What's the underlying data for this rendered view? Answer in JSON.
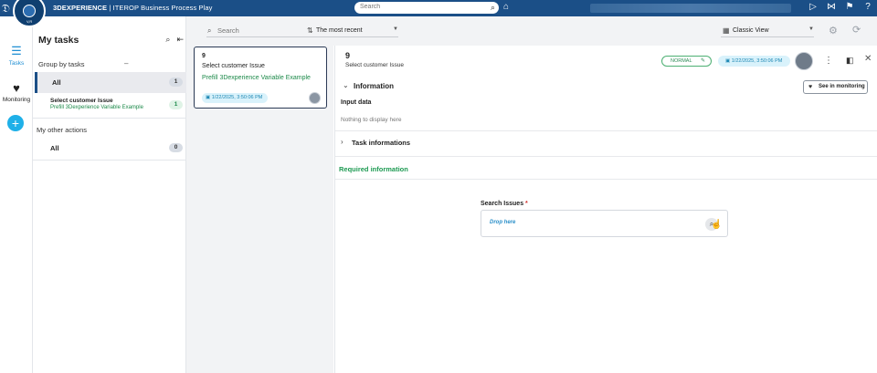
{
  "header": {
    "brand_bold": "3DEXPERIENCE",
    "brand_rest": " | ITEROP Business Process Play",
    "search_placeholder": "Search",
    "compass_version": "V,R",
    "blurred": true
  },
  "rail": {
    "tasks_label": "Tasks",
    "monitoring_label": "Monitoring",
    "add_label": "+"
  },
  "tasks_panel": {
    "title": "My tasks",
    "group_by": "Group by tasks",
    "all_label": "All",
    "all_count": "1",
    "task_name": "Select customer Issue",
    "task_process": "Prefill 3Dexperience Variable Example",
    "task_count": "1",
    "other_actions": "My other actions",
    "other_all_label": "All",
    "other_all_count": "0"
  },
  "filters": {
    "search_placeholder": "Search",
    "sort_label": "The most recent",
    "view_label": "Classic View"
  },
  "card": {
    "number": "9",
    "name": "Select customer Issue",
    "process": "Prefill 3Dexperience Variable Example",
    "date": "1/22/2025, 3:50:06 PM"
  },
  "detail": {
    "number": "9",
    "name": "Select customer Issue",
    "status": "NORMAL",
    "date": "1/22/2025, 3:50:06 PM",
    "information_title": "Information",
    "see_in_monitoring": "See in monitoring",
    "input_data": "Input data",
    "nothing_to_display": "Nothing to display here",
    "task_informations": "Task informations",
    "required_information": "Required information",
    "search_issues_label": "Search Issues",
    "required_star": "*",
    "drop_here": "Drop here"
  },
  "colors": {
    "header_bg": "#1b4f87",
    "accent_blue": "#1f8ed3",
    "green": "#1d8a4a",
    "date_pill_bg": "#d9f2fb",
    "required_star": "#d0312d"
  }
}
